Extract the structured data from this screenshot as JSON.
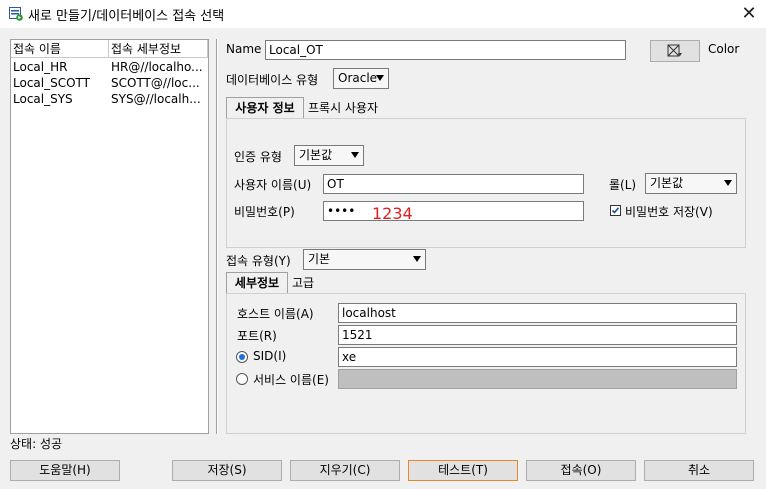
{
  "window": {
    "title": "새로 만들기/데이터베이스 접속 선택",
    "close": "✕"
  },
  "connections": {
    "columns": [
      "접속 이름",
      "접속 세부정보"
    ],
    "rows": [
      {
        "name": "Local_HR",
        "details": "HR@//localho..."
      },
      {
        "name": "Local_SCOTT",
        "details": "SCOTT@//loc..."
      },
      {
        "name": "Local_SYS",
        "details": "SYS@//localh..."
      }
    ]
  },
  "form": {
    "name_label": "Name",
    "name_value": "Local_OT",
    "color_label": "Color",
    "db_type_label": "데이터베이스 유형",
    "db_type_value": "Oracle",
    "tabs": {
      "user_info": "사용자 정보",
      "proxy_user": "프록시 사용자"
    },
    "auth_type_label": "인증 유형",
    "auth_type_value": "기본값",
    "username_label": "사용자 이름(U)",
    "username_value": "OT",
    "role_label": "롤(L)",
    "role_value": "기본값",
    "password_label": "비밀번호(P)",
    "password_value": "••••",
    "password_annotation": "1234",
    "save_password_label": "비밀번호 저장(V)",
    "save_password_checked": true,
    "conn_type_label": "접속 유형(Y)",
    "conn_type_value": "기본",
    "detail_tabs": {
      "details": "세부정보",
      "advanced": "고급"
    },
    "host_label": "호스트 이름(A)",
    "host_value": "localhost",
    "port_label": "포트(R)",
    "port_value": "1521",
    "sid_label": "SID(I)",
    "sid_value": "xe",
    "service_label": "서비스 이름(E)",
    "service_value": ""
  },
  "status": {
    "text": "상태: 성공"
  },
  "buttons": {
    "help": "도움말(H)",
    "save": "저장(S)",
    "clear": "지우기(C)",
    "test": "테스트(T)",
    "connect": "접속(O)",
    "cancel": "취소"
  },
  "colors": {
    "annotation": "#e02020",
    "focus_border": "#e08a2c",
    "radio_dot": "#1e6fd9"
  }
}
